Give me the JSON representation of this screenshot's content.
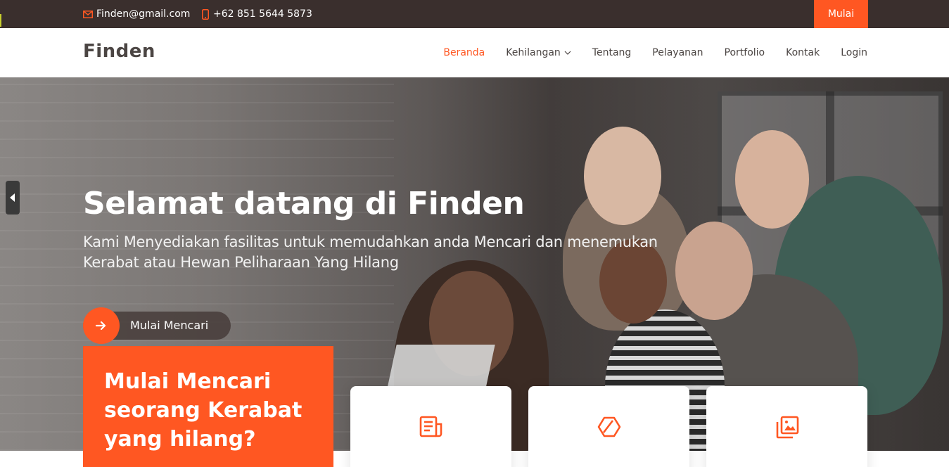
{
  "topbar": {
    "email": "Finden@gmail.com",
    "phone": "+62 851 5644 5873",
    "start_label": "Mulai",
    "email_icon": "envelope-icon",
    "phone_icon": "phone-icon"
  },
  "header": {
    "logo": "Finden",
    "nav": [
      {
        "label": "Beranda",
        "active": true
      },
      {
        "label": "Kehilangan",
        "dropdown": true
      },
      {
        "label": "Tentang"
      },
      {
        "label": "Pelayanan"
      },
      {
        "label": "Portfolio"
      },
      {
        "label": "Kontak"
      },
      {
        "label": "Login"
      }
    ]
  },
  "hero": {
    "title": "Selamat datang di Finden",
    "subtitle": "Kami Menyediakan fasilitas untuk memudahkan anda Mencari dan menemukan Kerabat atau Hewan Peliharaan Yang Hilang",
    "cta_label": "Mulai Mencari",
    "cta_icon": "arrow-right-icon"
  },
  "card": {
    "text": "Mulai Mencari seorang Kerabat yang hilang?"
  },
  "features": [
    {
      "icon": "news-icon",
      "title": ""
    },
    {
      "icon": "box-icon",
      "title": ""
    },
    {
      "icon": "images-icon",
      "title": ""
    }
  ],
  "colors": {
    "accent": "#ff5722",
    "topbar": "#3a2f2d",
    "text": "#4b4543"
  }
}
